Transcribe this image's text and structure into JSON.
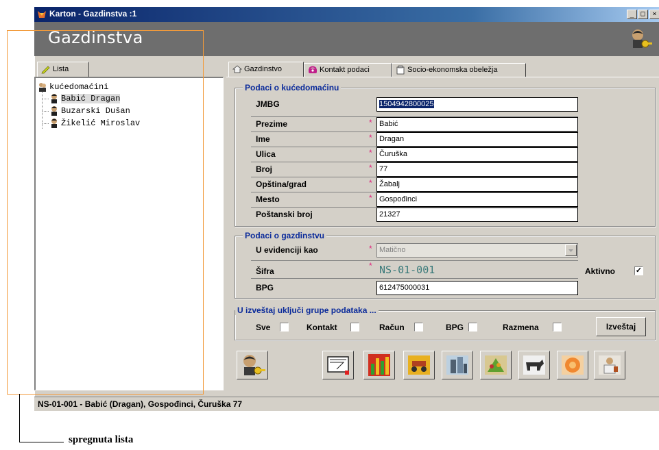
{
  "window": {
    "title": "Karton - Gazdinstva :1",
    "controls": [
      "_",
      "□",
      "×"
    ]
  },
  "header": {
    "title": "Gazdinstva"
  },
  "left_tab": {
    "label": "Lista"
  },
  "tree": {
    "root": "kućedomaćini",
    "items": [
      "Babić Dragan",
      "Buzarski Dušan",
      "Žikelić Miroslav"
    ]
  },
  "tabs": [
    {
      "label": "Gazdinstvo",
      "icon": "house-icon"
    },
    {
      "label": "Kontakt podaci",
      "icon": "phone-icon"
    },
    {
      "label": "Socio-ekonomska obeležja",
      "icon": "document-icon"
    }
  ],
  "owner_group": {
    "label": "Podaci o kućedomaćinu",
    "fields": [
      {
        "label": "JMBG",
        "value": "1504942800025",
        "required": false
      },
      {
        "label": "Prezime",
        "value": "Babić",
        "required": true
      },
      {
        "label": "Ime",
        "value": "Dragan",
        "required": true
      },
      {
        "label": "Ulica",
        "value": "Čuruška",
        "required": true
      },
      {
        "label": "Broj",
        "value": "77",
        "required": true
      },
      {
        "label": "Opština/grad",
        "value": "Žabalj",
        "required": true
      },
      {
        "label": "Mesto",
        "value": "Gospođinci",
        "required": true
      },
      {
        "label": "Poštanski broj",
        "value": "21327",
        "required": false
      }
    ]
  },
  "farm_group": {
    "label": "Podaci o gazdinstvu",
    "evidencija_label": "U evidenciji kao",
    "evidencija_value": "Matično",
    "sifra_label": "Šifra",
    "sifra_value": "NS-01-001",
    "aktivno_label": "Aktivno",
    "aktivno_checked": true,
    "bpg_label": "BPG",
    "bpg_value": "612475000031"
  },
  "report_group": {
    "label": "U izveštaj uključi grupe podataka ...",
    "options": [
      "Sve",
      "Kontakt",
      "Račun",
      "BPG",
      "Razmena"
    ],
    "button": "Izveštaj"
  },
  "status": "NS-01-001 - Babić (Dragan), Gospođinci, Čuruška 77",
  "annotation": "spregnuta lista",
  "colors": {
    "group_label": "#0a2a9a",
    "required": "#e0207a",
    "code": "#3a7a7a",
    "overlay": "#f29a3a"
  }
}
